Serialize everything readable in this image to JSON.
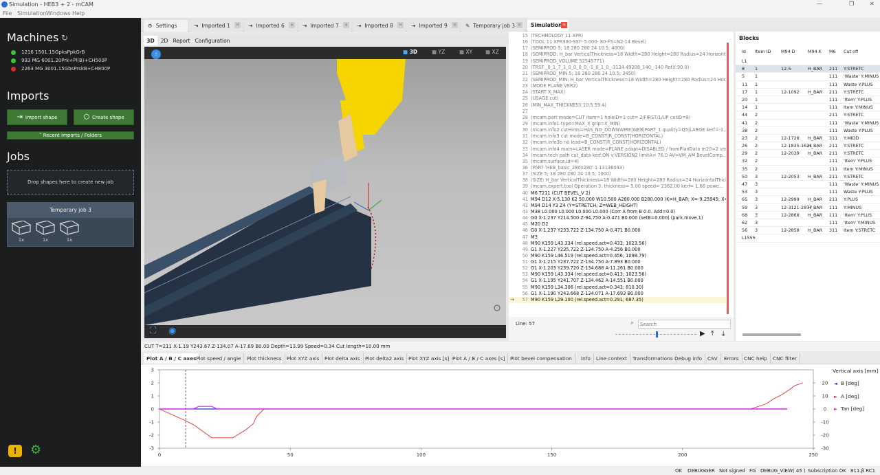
{
  "window": {
    "title": "Simulation - HEB3 + 2 - mCAM",
    "menu": [
      "File",
      "Simulation",
      "Windows",
      "Help"
    ],
    "controls": [
      "—",
      "❐",
      "✕"
    ]
  },
  "sidebar": {
    "machines_title": "Machines",
    "machines": [
      {
        "label": "1216 1501.15GpksPpkGrB",
        "status_color": "#37c837"
      },
      {
        "label": "993 MG 6001.20Prk+Pl(B)+CH500P",
        "status_color": "#37c837"
      },
      {
        "label": "2263 MG 3001.15GbsPrskB+CH800P",
        "status_color": "#e02b2b"
      }
    ],
    "imports_title": "Imports",
    "import_button": "Import shape",
    "create_button": "Create shape",
    "recent_imports": "˅ Recent imports / Folders",
    "jobs_title": "Jobs",
    "drop_text": "Drop shapes here to create new job",
    "temp_job": {
      "title": "Temporary job 3",
      "items": [
        "1x",
        "1x",
        "1x"
      ]
    }
  },
  "tabs": [
    {
      "label": "Settings",
      "icon": "gear-icon"
    },
    {
      "label": "Imported 1",
      "icon": "import-icon"
    },
    {
      "label": "Imported 6",
      "icon": "import-icon"
    },
    {
      "label": "Imported 7",
      "icon": "import-icon"
    },
    {
      "label": "Imported 8",
      "icon": "import-icon"
    },
    {
      "label": "Imported 9",
      "icon": "import-icon"
    },
    {
      "label": "Temporary job 3",
      "icon": "pencil-icon"
    }
  ],
  "simulation_tab": {
    "label": "Simulation",
    "close": "×"
  },
  "view_tabs": [
    "3D",
    "2D",
    "Report",
    "Configuration"
  ],
  "view_buttons": [
    "3D",
    "YZ",
    "XY",
    "XZ"
  ],
  "code": {
    "lines": [
      {
        "n": "15",
        "t": "(TECHNOLOGY 11 XPR)"
      },
      {
        "n": "16",
        "t": "(TOOL 11 XPR300-SST-  5.000-  80-F5=N2-14 Bevel)"
      },
      {
        "n": "17",
        "t": "(SEMIPROD 5; 18 280 280 24 10.5; 4000)"
      },
      {
        "n": "18",
        "t": "(SEMIPROD: H_bar VerticalThickness=18 Width=280 Height=280 Radius=24 Horizont..."
      },
      {
        "n": "19",
        "t": "(SEMIPROD_VOLUME 52545771)"
      },
      {
        "n": "20",
        "t": "(TRSF _0_1_7_1_0_0_0_0_-1_0_1_0_-3124.49208_140_-140 RotX:90.0)"
      },
      {
        "n": "21",
        "t": "(SEMIPROD_MIN 5; 18 280 280 24 10.5; 3450)"
      },
      {
        "n": "22",
        "t": "(SEMIPROD_MIN: H_bar VerticalThickness=18 Width=280 Height=280 Radius=24 Hor..."
      },
      {
        "n": "23",
        "t": "(MODE PLANE VER2)"
      },
      {
        "n": "24",
        "t": "(START X_MAX)"
      },
      {
        "n": "25",
        "t": "(USAGE cut)"
      },
      {
        "n": "26",
        "t": "(MIN_MAX_THICKNESS 10.5 59.4)"
      },
      {
        "n": "27",
        "t": ""
      },
      {
        "n": "28",
        "t": "(mcam.part mode=CUT item=1 holeID=1 cut= 2/FIRST/1/UP cutID=8)"
      },
      {
        "n": "29",
        "t": "(mcam.info1 type=MAX_X grip=X_MIN)"
      },
      {
        "n": "30",
        "t": "(mcam.info2 cutHints=HAS_NO_DOWNWIRE|WEB|PART_1 quality=Q5|LARGE kerf=-1..."
      },
      {
        "n": "31",
        "t": "(mcam.info3 cut mode=B_CONST|R_CONST|HORIZONTAL)"
      },
      {
        "n": "32",
        "t": "(mcam.info3b no lead=B_CONST|R_CONST|HORIZONTAL)"
      },
      {
        "n": "33",
        "t": "(mcam.info4 main=LASER mode=PLANE adapt=DISABLED / fromPlanData m20=2 ver..."
      },
      {
        "n": "34",
        "t": "(mcam.tech path cut_data kerf:ON v:VERSION2 limitA=  76.0 AV=VM_AM BevelComp..."
      },
      {
        "n": "35",
        "t": "(mcam.surface.id=4)"
      },
      {
        "n": "36",
        "t": "(PART 'HEB_basic_280x280' 1 13136443)"
      },
      {
        "n": "37",
        "t": "(SIZE 5; 18 280 280 24 10.5; 1000)"
      },
      {
        "n": "38",
        "t": "(SIZE: H_bar VerticalThickness=18 Width=280 Height=280 Radius=24 HorizontalThick..."
      },
      {
        "n": "39",
        "t": "(mcam.expert.tool  Operation 3. thickness=   5.00 speed= 2362.00 kerf=   1.66 powe..."
      },
      {
        "n": "40",
        "t": "M6 T211 (CUT BEVEL_V 2)"
      },
      {
        "n": "41",
        "t": "M94 D12 X-5.130 K2 50.000 W10.500 A280.000 B280.000 (K=H_BAR; X=-9.25945; X=-1)"
      },
      {
        "n": "42",
        "t": "M94 D14 Y3 Z4 (Y=STRETCH; Z=WEB_HEIGHT)"
      },
      {
        "n": "43",
        "t": "M38 L0.000 L0.000 L0.000 L0.000 (Corr A from B 0.0. Add=0.0)"
      },
      {
        "n": "44",
        "t": "G0 X-1.237 Y214.500 Z-94.750 A-0.471 B0.000 (setB=0.000) (park.move.1)"
      },
      {
        "n": "45",
        "t": "M20 D2"
      },
      {
        "n": "46",
        "t": "G0 X-1.237 Y233.722 Z-134.750 A-0.471 B0.000"
      },
      {
        "n": "47",
        "t": "M3"
      },
      {
        "n": "48",
        "t": "M90 K159 L43.334 (rel.speed.act=0.433; 1023.56)"
      },
      {
        "n": "49",
        "t": "G1 X-1.227 Y235.722 Z-134.750 A-4.256 B0.000"
      },
      {
        "n": "50",
        "t": "M90 K159 L46.519 (rel.speed.act=0.456; 1098.79)"
      },
      {
        "n": "51",
        "t": "G1 X-1.215 Y237.722 Z-134.750 A-7.893 B0.000"
      },
      {
        "n": "52",
        "t": "G1 X-1.203 Y239.720 Z-134.688 A-11.261 B0.000"
      },
      {
        "n": "53",
        "t": "M90 K159 L43.334 (rel.speed.act=0.413; 1023.56)"
      },
      {
        "n": "54",
        "t": "G1 X-1.195 Y241.707 Z-134.462 A-14.551 B0.000"
      },
      {
        "n": "55",
        "t": "M90 K159 L34.306 (rel.speed.act=0.343; 810.30)"
      },
      {
        "n": "56",
        "t": "G1 X-1.190 Y243.668 Z-134.071 A-17.693 B0.000"
      },
      {
        "n": "57",
        "t": "M90 K159 L29.100 (rel.speed.act=0.291; 687.35)"
      }
    ],
    "line_indicator": "Line: 57",
    "search_placeholder": "Search",
    "current_marker": "→"
  },
  "blocks": {
    "title": "Blocks",
    "columns": [
      "Id",
      "Item ID",
      "M94 D",
      "M94 K",
      "M6",
      "Cut off"
    ],
    "rows": [
      [
        "L1",
        "",
        "",
        "",
        "",
        ""
      ],
      [
        "8",
        "1",
        "12-5",
        "H_BAR",
        "211",
        "Y:STRETC"
      ],
      [
        "5",
        "1",
        "",
        "",
        "111",
        "'Waste' Y:MINUS"
      ],
      [
        "11",
        "1",
        "",
        "",
        "111",
        "Waste Y:PLUS"
      ],
      [
        "17",
        "1",
        "12-1092",
        "H_BAR",
        "211",
        "Y:STRETC"
      ],
      [
        "20",
        "1",
        "",
        "",
        "111",
        "'Item' Y:PLUS"
      ],
      [
        "14",
        "1",
        "",
        "",
        "111",
        "Item Y:MINUS"
      ],
      [
        "44",
        "2",
        "",
        "",
        "211",
        "Y:STRETC"
      ],
      [
        "41",
        "2",
        "",
        "",
        "111",
        "'Waste' Y:MINUS"
      ],
      [
        "38",
        "2",
        "",
        "",
        "111",
        "Waste Y:PLUS"
      ],
      [
        "23",
        "2",
        "12-1728",
        "H_BAR",
        "311",
        "Y:MIDD"
      ],
      [
        "26",
        "2",
        "12-1835-1621",
        "H_BAR",
        "211",
        "Y:STRETC"
      ],
      [
        "29",
        "2",
        "12-2039",
        "H_BAR",
        "211",
        "Y:STRETC"
      ],
      [
        "32",
        "2",
        "",
        "",
        "111",
        "'Item' Y:PLUS"
      ],
      [
        "35",
        "2",
        "",
        "",
        "111",
        "Item Y:MINUS"
      ],
      [
        "50",
        "3",
        "12-2053",
        "H_BAR",
        "211",
        "Y:STRETC"
      ],
      [
        "47",
        "3",
        "",
        "",
        "111",
        "'Waste' Y:MINUS"
      ],
      [
        "53",
        "3",
        "",
        "",
        "111",
        "Waste Y:PLUS"
      ],
      [
        "65",
        "3",
        "12-2999",
        "H_BAR",
        "211",
        "Y:PLUS"
      ],
      [
        "59",
        "3",
        "12-3121-2877",
        "H_BAR",
        "111",
        "Y:MINUS"
      ],
      [
        "68",
        "3",
        "12-2868",
        "H_BAR",
        "111",
        "'Item' Y:PLUS"
      ],
      [
        "62",
        "3",
        "",
        "",
        "111",
        "'Item' Y:MINUS"
      ],
      [
        "56",
        "3",
        "12-2858",
        "H_BAR",
        "311",
        "Item Y:STRETC"
      ],
      [
        "L1555",
        "",
        "",
        "",
        "",
        ""
      ]
    ]
  },
  "status_line": "CUT T=211 X-1.19 Y243.67 Z-134.07 A-17.69 B0.00 Depth=13.99 Speed=0.34 Cut length=10.00 mm",
  "plot_tabs": [
    "Plot A / B / C axes",
    "Plot speed / angle",
    "Plot thickness",
    "Plot XYZ axis",
    "Plot delta axis",
    "Plot delta2 axis",
    "Plot XYZ axis [s]",
    "Plot A / B / C axes [s]",
    "Plot bevel compensation",
    "Info",
    "Line context",
    "Transformations",
    "Debug info",
    "CSV",
    "Errors",
    "CNC help",
    "CNC filter"
  ],
  "chart_data": {
    "type": "line",
    "xlim": [
      0,
      250
    ],
    "ylim_left": [
      -3,
      3
    ],
    "ylim_right": [
      -30,
      30
    ],
    "x_ticks": [
      "0",
      "50",
      "100",
      "150",
      "200",
      "250"
    ],
    "y_ticks_left": [
      "3",
      "2",
      "1",
      "0",
      "-1",
      "-2",
      "-3"
    ],
    "y_ticks_right": [
      "20",
      "10",
      "0",
      "-10",
      "-20",
      "-30"
    ],
    "legend_title": "Vertical axis [mm]",
    "series": [
      {
        "name": "B [deg]",
        "color": "#2233cc",
        "x": [
          0,
          240
        ],
        "y": [
          0,
          0
        ]
      },
      {
        "name": "A [deg]",
        "color": "#e03030",
        "x": [
          0,
          10,
          13,
          20,
          22,
          28,
          33,
          36,
          37,
          40,
          50,
          100,
          150,
          200,
          222,
          226,
          232,
          235,
          238,
          241,
          243,
          246
        ],
        "y": [
          0,
          -9,
          -12,
          -22,
          -22,
          -22,
          -16,
          -11,
          -6,
          0,
          0,
          0,
          0,
          0,
          0,
          0,
          4,
          8,
          11,
          15,
          18,
          20
        ]
      },
      {
        "name": "Tan [deg]",
        "color": "#dd22dd",
        "x": [
          0,
          13,
          15,
          20,
          22,
          240
        ],
        "y": [
          0,
          0,
          2,
          2,
          0,
          0
        ]
      }
    ],
    "marker_x": 10
  },
  "bottom": {
    "items": [
      "OK",
      "DEBUGGER",
      "Not signed",
      "FG",
      "DEBUG_VIEW( 45 )",
      "Subscription OK",
      "811.β RC1"
    ]
  }
}
